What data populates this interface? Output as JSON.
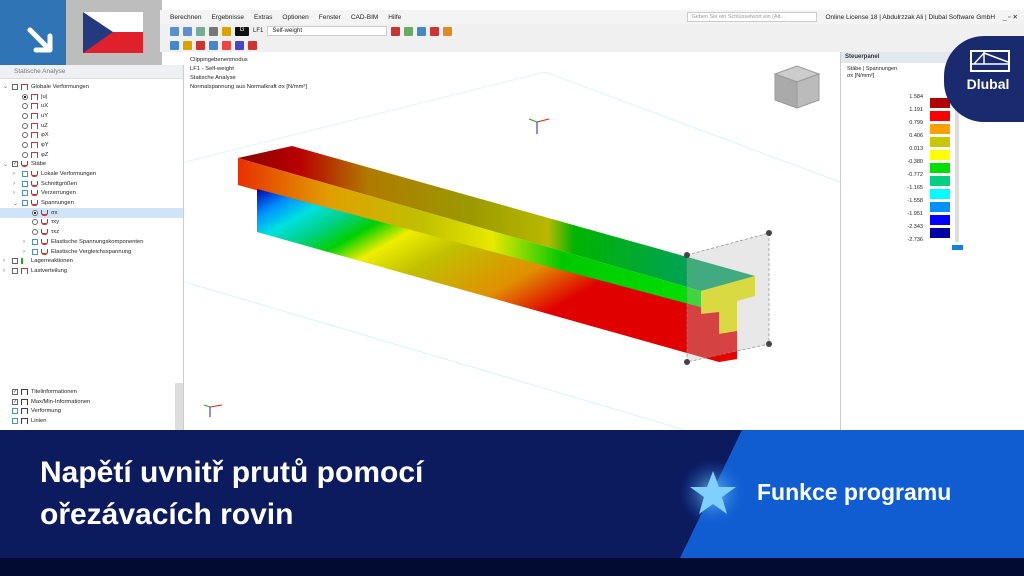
{
  "menu": [
    "Berechnen",
    "Ergebnisse",
    "Extras",
    "Optionen",
    "Fenster",
    "CAD-BIM",
    "Hilfe"
  ],
  "search_placeholder": "Geben Sie ein Schlüsselwort ein (Alt...",
  "license": "Online License 18 | Abdulrzzak Ali | Dlubal Software GmbH",
  "loadcase": {
    "id": "LF1",
    "name": "Self-weight",
    "code": "G"
  },
  "navigator": {
    "title": "Statische Analyse",
    "items": [
      {
        "label": "Globale Verformungen",
        "level": 0,
        "ctl": "chk",
        "icon": "frame",
        "exp": "v"
      },
      {
        "label": "|u|",
        "level": 1,
        "ctl": "rad-on",
        "icon": "frame"
      },
      {
        "label": "uX",
        "level": 1,
        "ctl": "rad",
        "icon": "frame"
      },
      {
        "label": "uY",
        "level": 1,
        "ctl": "rad",
        "icon": "frame"
      },
      {
        "label": "uZ",
        "level": 1,
        "ctl": "rad",
        "icon": "frame"
      },
      {
        "label": "φX",
        "level": 1,
        "ctl": "rad",
        "icon": "frame"
      },
      {
        "label": "φY",
        "level": 1,
        "ctl": "rad",
        "icon": "frame"
      },
      {
        "label": "φZ",
        "level": 1,
        "ctl": "rad",
        "icon": "frame"
      },
      {
        "label": "Stäbe",
        "level": 0,
        "ctl": "chk-on",
        "icon": "member",
        "exp": "v"
      },
      {
        "label": "Lokale Verformungen",
        "level": 1,
        "ctl": "chkb",
        "icon": "member",
        "exp": ">"
      },
      {
        "label": "Schnittgrößen",
        "level": 1,
        "ctl": "chkb",
        "icon": "member",
        "exp": ">"
      },
      {
        "label": "Verzerrungen",
        "level": 1,
        "ctl": "chkb",
        "icon": "member",
        "exp": ">"
      },
      {
        "label": "Spannungen",
        "level": 1,
        "ctl": "chkb",
        "icon": "member",
        "exp": "v"
      },
      {
        "label": "σx",
        "level": 2,
        "ctl": "rad-on",
        "icon": "member",
        "sel": true
      },
      {
        "label": "τxy",
        "level": 2,
        "ctl": "rad",
        "icon": "member"
      },
      {
        "label": "τxz",
        "level": 2,
        "ctl": "rad",
        "icon": "member"
      },
      {
        "label": "Elastische Spannungskomponenten",
        "level": 2,
        "ctl": "chkb",
        "icon": "member",
        "exp": ">"
      },
      {
        "label": "Elastische Vergleichsspannung",
        "level": 2,
        "ctl": "chkb",
        "icon": "member",
        "exp": ">"
      },
      {
        "label": "Lagerreaktionen",
        "level": 0,
        "ctl": "chk",
        "icon": "support",
        "exp": ">"
      },
      {
        "label": "Lastverteilung",
        "level": 0,
        "ctl": "chk",
        "icon": "frame",
        "exp": ">"
      }
    ],
    "display_items": [
      {
        "label": "Titelinformationen",
        "ctl": "chk-on"
      },
      {
        "label": "Max/Min-Informationen",
        "ctl": "chk-on"
      },
      {
        "label": "Verformung",
        "ctl": "chkb"
      },
      {
        "label": "Linien",
        "ctl": "chkb"
      }
    ]
  },
  "view_info": [
    "Clippingebenenmodus",
    "LF1 - Self-weight",
    "Statische Analyse",
    "Normalspannung aus Normalkraft σx [N/mm²]"
  ],
  "panel": {
    "title": "Steuerpanel",
    "subtitle": "Stäbe | Spannungen",
    "unit": "σx [N/mm²]",
    "legend": [
      {
        "value": "1.584",
        "color": "#b00000"
      },
      {
        "value": "1.191",
        "color": "#ff0000"
      },
      {
        "value": "0.799",
        "color": "#ffa000"
      },
      {
        "value": "0.406",
        "color": "#c8c800"
      },
      {
        "value": "0.013",
        "color": "#ffff00"
      },
      {
        "value": "-0.380",
        "color": "#00e000"
      },
      {
        "value": "-0.772",
        "color": "#00d080"
      },
      {
        "value": "-1.165",
        "color": "#00ffff"
      },
      {
        "value": "-1.558",
        "color": "#0090ff"
      },
      {
        "value": "-1.951",
        "color": "#0000ff"
      },
      {
        "value": "-2.343",
        "color": "#0000a0"
      },
      {
        "value": "-2.736",
        "color": ""
      }
    ]
  },
  "logo_text": "Dlubal",
  "banner": {
    "title_line1": "Napětí uvnitř prutů pomocí",
    "title_line2": "ořezávacích rovin",
    "tag": "Funkce programu"
  }
}
